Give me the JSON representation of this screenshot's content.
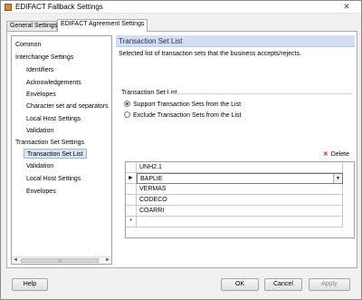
{
  "window": {
    "title": "EDIFACT Fallback Settings",
    "close_glyph": "✕"
  },
  "tabs": [
    {
      "label": "General Settings"
    },
    {
      "label": "EDIFACT Agreement Settings"
    }
  ],
  "tree": {
    "items": [
      {
        "label": "Common"
      },
      {
        "label": "Interchange Settings"
      },
      {
        "label": "Identifiers"
      },
      {
        "label": "Acknowledgements"
      },
      {
        "label": "Envelopes"
      },
      {
        "label": "Character set and separators"
      },
      {
        "label": "Local Host Settings"
      },
      {
        "label": "Validation"
      },
      {
        "label": "Transaction Set Settings"
      },
      {
        "label": "Transaction Set List"
      },
      {
        "label": "Validation"
      },
      {
        "label": "Local Host Settings"
      },
      {
        "label": "Envelopes"
      }
    ],
    "scroll_left": "◄",
    "scroll_right": "►",
    "scroll_thumb": "III"
  },
  "content": {
    "header": "Transaction Set List",
    "description": "Selected list of transaction sets that the business accepts/rejects.",
    "group_label": "Transaction Set List",
    "radio_support": "Support Transaction Sets from the List",
    "radio_exclude": "Exclude Transaction Sets from the List",
    "delete_icon": "✕",
    "delete_label": "Delete"
  },
  "grid": {
    "header": "UNH2.1",
    "rows": [
      "BAPLIE",
      "VERMAS",
      "CODECO",
      "COARRI"
    ],
    "current_marker": "►",
    "new_row_marker": "*",
    "dropdown_glyph": "▼"
  },
  "buttons": {
    "help": "Help",
    "ok": "OK",
    "cancel": "Cancel",
    "apply": "Apply"
  }
}
